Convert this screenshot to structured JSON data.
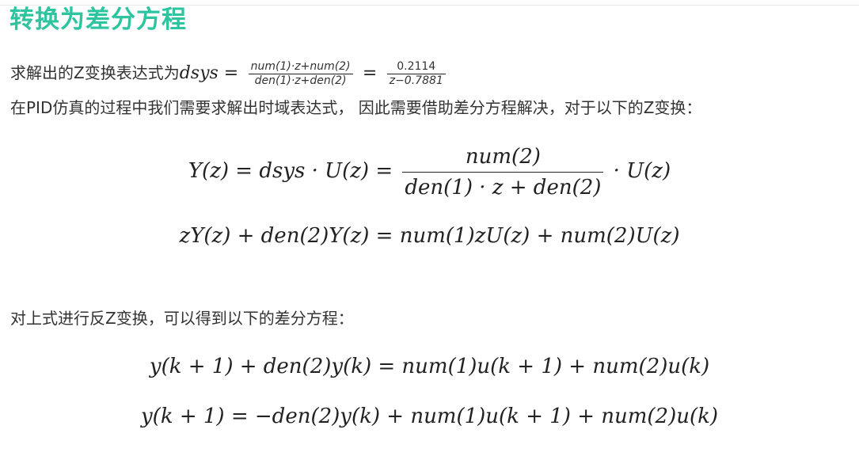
{
  "heading": "转换为差分方程",
  "para1": {
    "text": "求解出的Z变换表达式为",
    "lhs": "dsys =",
    "frac1_num": "num(1)·z+num(2)",
    "frac1_den": "den(1)·z+den(2)",
    "equals": "=",
    "frac2_num": "0.2114",
    "frac2_den": "z−0.7881"
  },
  "para2": "在PID仿真的过程中我们需要求解出时域表达式， 因此需要借助差分方程解决，对于以下的Z变换：",
  "eq1": {
    "lhs": "Y(z) = dsys · U(z) =",
    "frac_num": "num(2)",
    "frac_den": "den(1) · z + den(2)",
    "rhs": "· U(z)"
  },
  "eq2": "zY(z) + den(2)Y(z) = num(1)zU(z) + num(2)U(z)",
  "para3": "对上式进行反Z变换，可以得到以下的差分方程：",
  "eq3": "y(k + 1) + den(2)y(k) = num(1)u(k + 1) + num(2)u(k)",
  "eq4": "y(k + 1) = −den(2)y(k) + num(1)u(k + 1) + num(2)u(k)"
}
